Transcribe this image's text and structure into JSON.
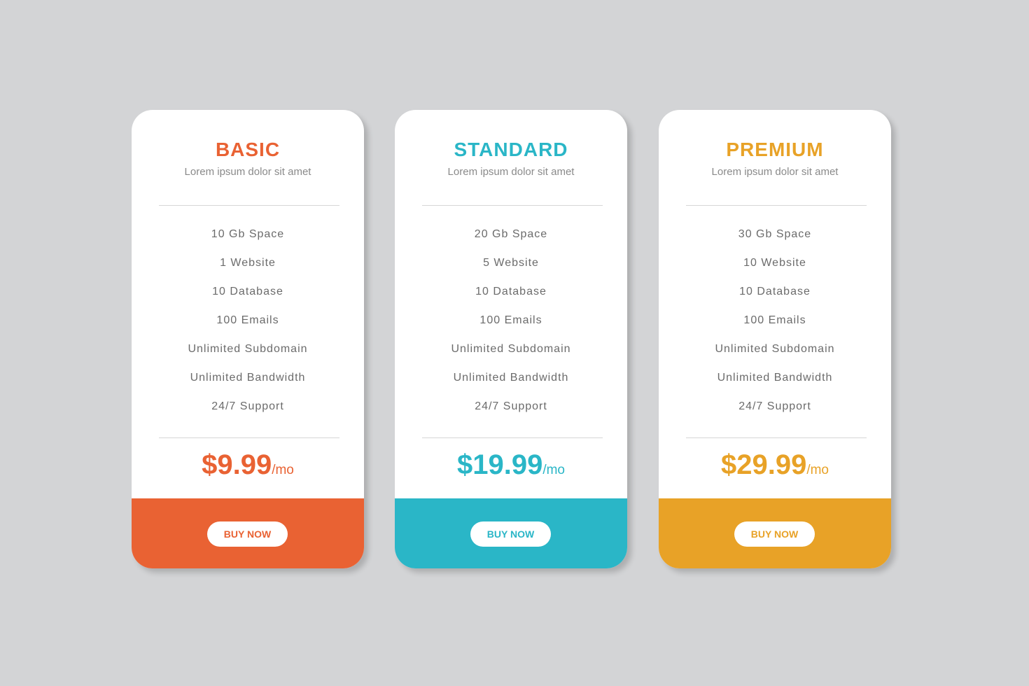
{
  "plans": [
    {
      "name": "BASIC",
      "subtitle": "Lorem ipsum dolor sit amet",
      "features": [
        "10 Gb Space",
        "1 Website",
        "10 Database",
        "100 Emails",
        "Unlimited Subdomain",
        "Unlimited Bandwidth",
        "24/7 Support"
      ],
      "price": "$9.99",
      "period": "/mo",
      "button_label": "BUY NOW",
      "accent": "#e96233"
    },
    {
      "name": "STANDARD",
      "subtitle": "Lorem ipsum dolor sit amet",
      "features": [
        "20 Gb Space",
        "5 Website",
        "10 Database",
        "100 Emails",
        "Unlimited Subdomain",
        "Unlimited Bandwidth",
        "24/7 Support"
      ],
      "price": "$19.99",
      "period": "/mo",
      "button_label": "BUY NOW",
      "accent": "#2ab6c7"
    },
    {
      "name": "PREMIUM",
      "subtitle": "Lorem ipsum dolor sit amet",
      "features": [
        "30 Gb Space",
        "10 Website",
        "10 Database",
        "100 Emails",
        "Unlimited Subdomain",
        "Unlimited Bandwidth",
        "24/7 Support"
      ],
      "price": "$29.99",
      "period": "/mo",
      "button_label": "BUY NOW",
      "accent": "#e8a227"
    }
  ]
}
